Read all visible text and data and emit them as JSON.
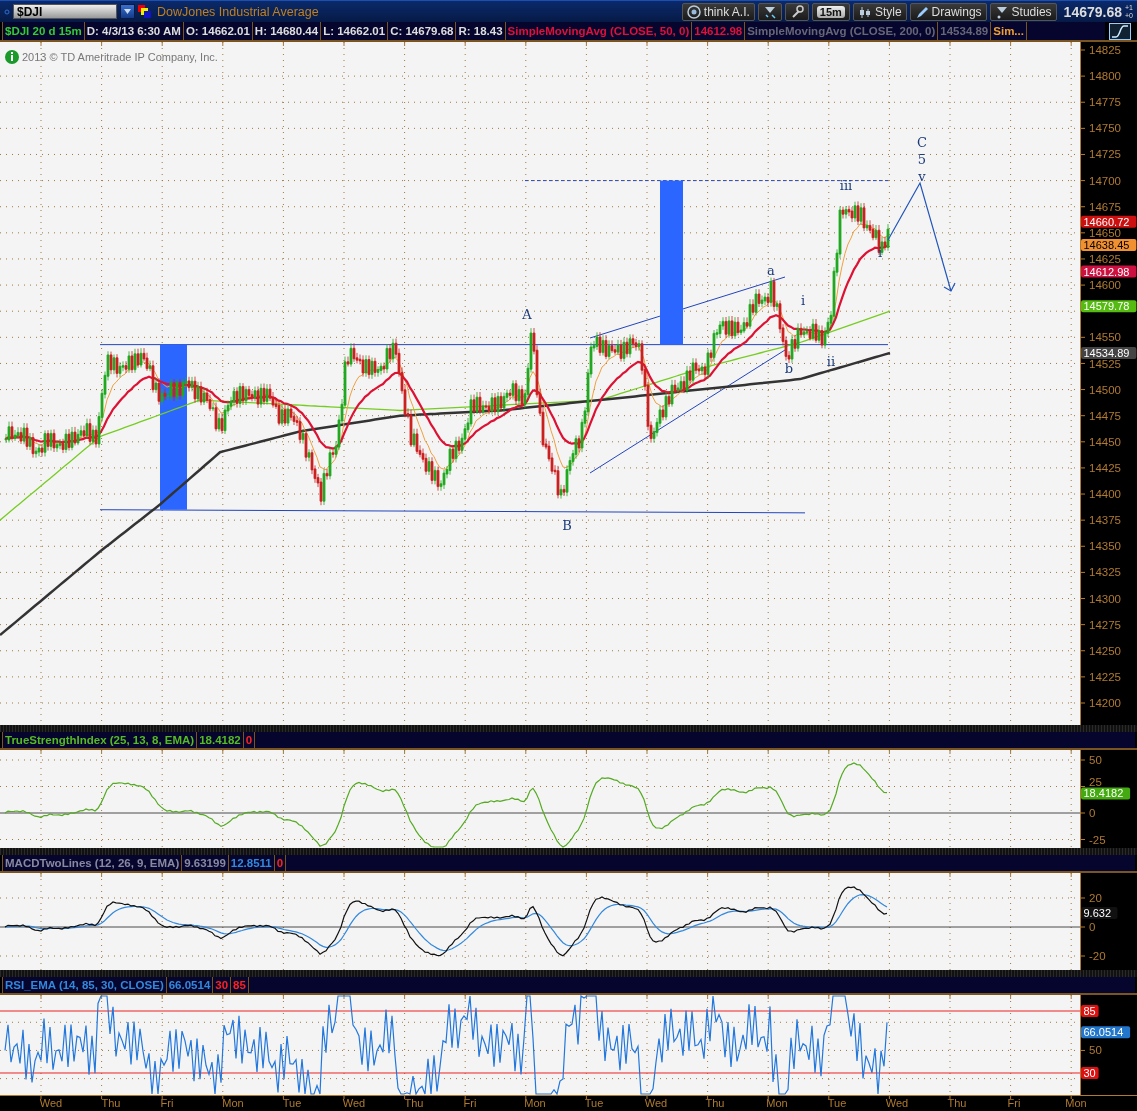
{
  "toolbar": {
    "symbol": "$DJI",
    "description": "DowJones Industrial Average",
    "tools": [
      {
        "kind": "text",
        "label": "think A.I."
      },
      {
        "kind": "icon"
      },
      {
        "kind": "icon"
      },
      {
        "kind": "chip",
        "label": "15m"
      },
      {
        "kind": "text",
        "label": "Style"
      },
      {
        "kind": "text",
        "label": "Drawings"
      },
      {
        "kind": "text",
        "label": "Studies"
      }
    ],
    "last_price": "14679.68",
    "change": [
      "+1",
      "+0"
    ]
  },
  "legend": [
    {
      "text": "$DJI 20 d 15m",
      "kind": "symbol"
    },
    {
      "text": "D: 4/3/13 6:30 AM",
      "kind": "quote"
    },
    {
      "text": "O: 14662.01",
      "kind": "quote"
    },
    {
      "text": "H: 14680.44",
      "kind": "quote"
    },
    {
      "text": "L: 14662.01",
      "kind": "quote"
    },
    {
      "text": "C: 14679.68",
      "kind": "quote"
    },
    {
      "text": "R: 18.43",
      "kind": "quote"
    },
    {
      "text": "SimpleMovingAvg (CLOSE, 50, 0)",
      "kind": "sma50"
    },
    {
      "text": "14612.98",
      "kind": "sma50"
    },
    {
      "text": "SimpleMovingAvg (CLOSE, 200, 0)",
      "kind": "sma200"
    },
    {
      "text": "14534.89",
      "kind": "sma200"
    },
    {
      "text": "Sim...",
      "kind": "sma-other"
    }
  ],
  "main_chart": {
    "copyright": "2013 © TD Ameritrade IP Company, Inc.",
    "wave_labels": [
      "A",
      "B",
      "a",
      "b",
      "i",
      "ii",
      "iii",
      "i",
      "C",
      "5",
      "v"
    ],
    "y_axis": [
      "14825",
      "14800",
      "14775",
      "14750",
      "14725",
      "14700",
      "14675",
      "14650",
      "14625",
      "14600",
      "14550",
      "14525",
      "14500",
      "14475",
      "14450",
      "14425",
      "14400",
      "14375",
      "14350",
      "14325",
      "14300",
      "14275",
      "14250",
      "14225",
      "14200"
    ],
    "price_tags": [
      {
        "text": "14660.72",
        "color": "#cc1010"
      },
      {
        "text": "14638.45",
        "color": "#f09030"
      },
      {
        "text": "14612.98",
        "color": "#cc1040"
      },
      {
        "text": "14579.78",
        "color": "#55bb11"
      },
      {
        "text": "14534.89",
        "color": "#444444"
      }
    ]
  },
  "studies": [
    {
      "kind": "tsi",
      "legend": [
        {
          "text": "TrueStrengthIndex (25, 13, 8, EMA)",
          "kind": "tsi"
        },
        {
          "text": "18.4182",
          "kind": "tsi"
        },
        {
          "text": "0",
          "kind": "level"
        }
      ],
      "y_axis": [
        "50",
        "25",
        "0",
        "-25"
      ],
      "tags": [
        {
          "text": "18.4182",
          "color": "#44aa11"
        }
      ]
    },
    {
      "kind": "macd",
      "legend": [
        {
          "text": "MACDTwoLines (12, 26, 9, EMA)",
          "kind": "macd"
        },
        {
          "text": "9.63199",
          "kind": "macd"
        },
        {
          "text": "12.8511",
          "kind": "signal"
        },
        {
          "text": "0",
          "kind": "level"
        }
      ],
      "y_axis": [
        "20",
        "0",
        "-20"
      ],
      "tags": [
        {
          "text": "9.632",
          "color": "#111111"
        }
      ]
    },
    {
      "kind": "rsi",
      "legend": [
        {
          "text": "RSI_EMA (14, 85, 30, CLOSE)",
          "kind": "rsi"
        },
        {
          "text": "66.0514",
          "kind": "rsi"
        },
        {
          "text": "30",
          "kind": "level"
        },
        {
          "text": "85",
          "kind": "level"
        }
      ],
      "y_axis": [
        "50"
      ],
      "tags": [
        {
          "text": "85",
          "color": "#dd1111"
        },
        {
          "text": "66.0514",
          "color": "#2277cc"
        },
        {
          "text": "30",
          "color": "#dd1111"
        }
      ]
    }
  ],
  "x_axis": [
    "Wed",
    "Thu",
    "Fri",
    "Mon",
    "Tue",
    "Wed",
    "Thu",
    "Fri",
    "Mon",
    "Tue",
    "Wed",
    "Thu",
    "Mon",
    "Tue",
    "Wed",
    "Thu",
    "Fri",
    "Mon"
  ]
}
